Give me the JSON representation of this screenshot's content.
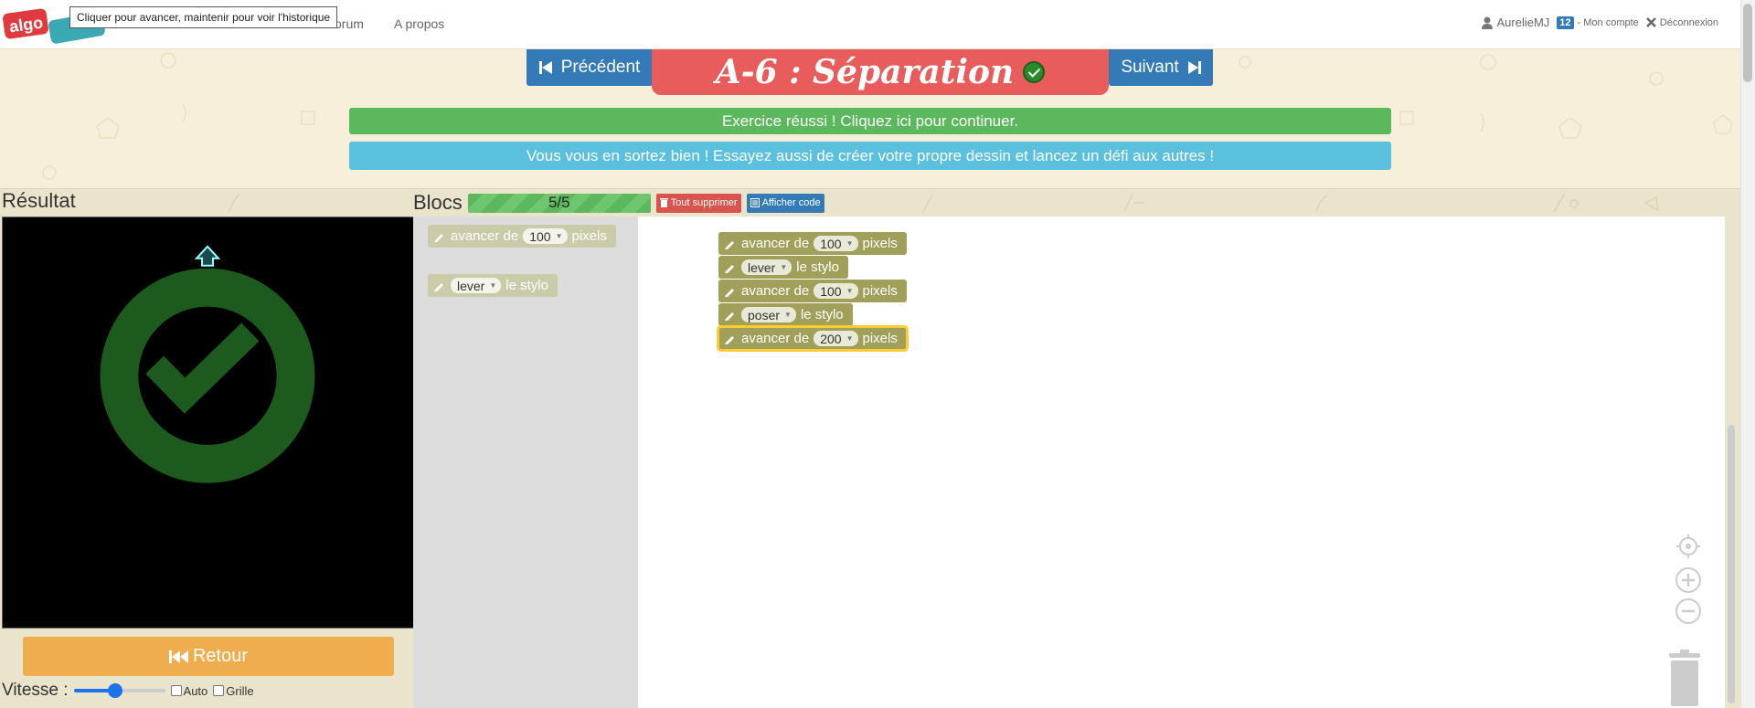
{
  "navbar": {
    "tooltip": "Cliquer pour avancer, maintenir pour voir l'historique",
    "links": [
      "Forum",
      "A propos"
    ],
    "forum_visible": "orum",
    "user": "AurelieMJ",
    "badge": "12",
    "account": "- Mon compte",
    "logout": "Déconnexion"
  },
  "header": {
    "prev_label": "Précédent",
    "next_label": "Suivant",
    "title": "A-6 : Séparation",
    "success_message": "Exercice réussi ! Cliquez ici pour continuer.",
    "info_message": "Vous vous en sortez bien ! Essayez aussi de créer votre propre dessin et lancez un défi aux autres !"
  },
  "result": {
    "label": "Résultat",
    "retour_label": "Retour",
    "speed_label": "Vitesse :",
    "speed_value": 0.45,
    "auto_label": "Auto",
    "grid_label": "Grille"
  },
  "blocks_panel": {
    "label": "Blocs",
    "progress_text": "5/5",
    "delete_all_label": "Tout supprimer",
    "show_code_label": "Afficher code"
  },
  "toolbox": [
    {
      "prefix": "avancer de",
      "value": "100",
      "suffix": "pixels"
    },
    {
      "prefix": "",
      "value": "lever",
      "suffix": "le stylo"
    }
  ],
  "program": [
    {
      "prefix": "avancer de",
      "value": "100",
      "suffix": "pixels"
    },
    {
      "prefix": "",
      "value": "lever",
      "suffix": "le stylo"
    },
    {
      "prefix": "avancer de",
      "value": "100",
      "suffix": "pixels"
    },
    {
      "prefix": "",
      "value": "poser",
      "suffix": "le stylo"
    },
    {
      "prefix": "avancer de",
      "value": "200",
      "suffix": "pixels"
    }
  ],
  "colors": {
    "block": "#a0a05b",
    "title_bg": "#e85c5c",
    "primary": "#337ab7",
    "success": "#5cb85c",
    "info": "#5bc0de",
    "warning": "#f0ad4e"
  }
}
